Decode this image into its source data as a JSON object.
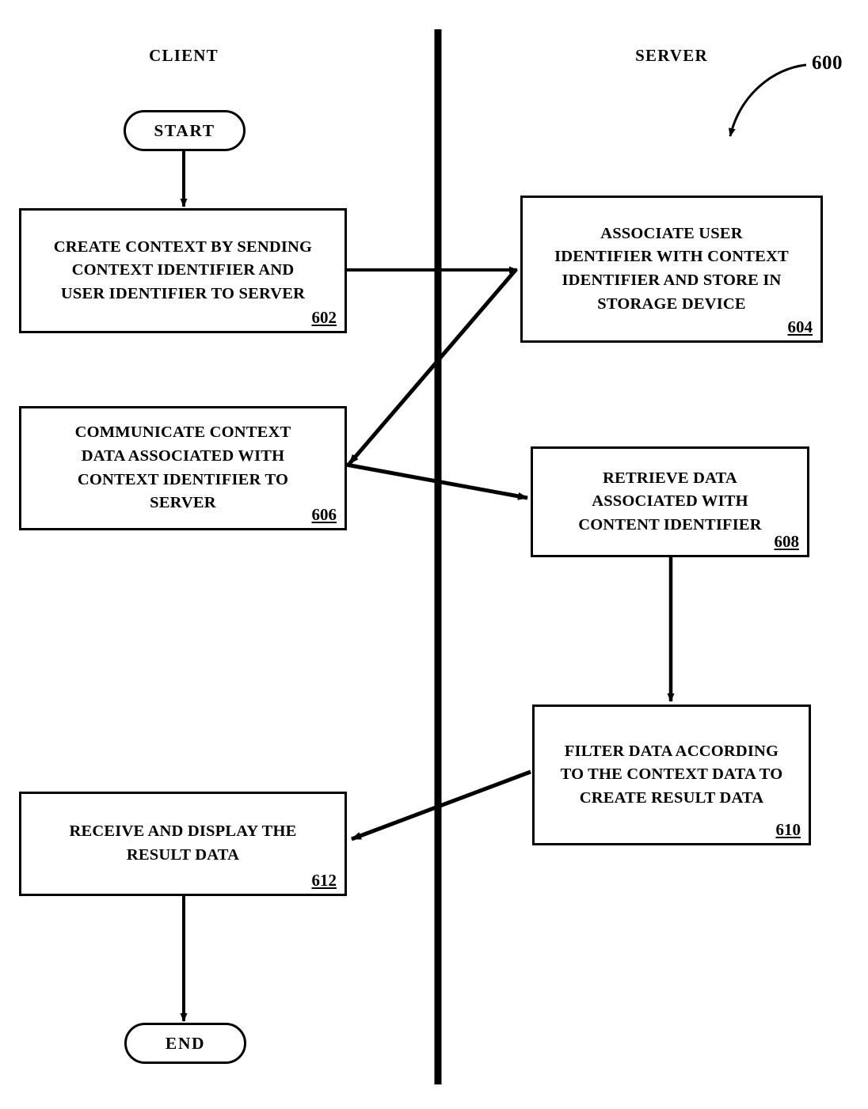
{
  "figure": {
    "reference_numeral": "600",
    "lanes": [
      {
        "id": "client",
        "label": "CLIENT"
      },
      {
        "id": "server",
        "label": "SERVER"
      }
    ]
  },
  "nodes": {
    "start": {
      "label": "START",
      "shape": "terminator"
    },
    "end": {
      "label": "END",
      "shape": "terminator"
    },
    "step602": {
      "number": "602",
      "lane": "client",
      "lines": [
        "CREATE CONTEXT BY SENDING",
        "CONTEXT IDENTIFIER AND",
        "USER IDENTIFIER TO SERVER"
      ]
    },
    "step604": {
      "number": "604",
      "lane": "server",
      "lines": [
        "ASSOCIATE USER",
        "IDENTIFIER WITH CONTEXT",
        "IDENTIFIER AND STORE IN",
        "STORAGE DEVICE"
      ]
    },
    "step606": {
      "number": "606",
      "lane": "client",
      "lines": [
        "COMMUNICATE CONTEXT",
        "DATA ASSOCIATED WITH",
        "CONTEXT IDENTIFIER TO",
        "SERVER"
      ]
    },
    "step608": {
      "number": "608",
      "lane": "server",
      "lines": [
        "RETRIEVE DATA",
        "ASSOCIATED WITH",
        "CONTENT IDENTIFIER"
      ]
    },
    "step610": {
      "number": "610",
      "lane": "server",
      "lines": [
        "FILTER DATA ACCORDING",
        "TO THE CONTEXT DATA TO",
        "CREATE RESULT DATA"
      ]
    },
    "step612": {
      "number": "612",
      "lane": "client",
      "lines": [
        "RECEIVE AND DISPLAY THE",
        "RESULT DATA"
      ]
    }
  },
  "edges": [
    {
      "from": "start",
      "to": "step602",
      "style": "straight-vertical"
    },
    {
      "from": "step602",
      "to": "step604",
      "style": "elbow-horizontal"
    },
    {
      "from": "step604",
      "to": "step606",
      "style": "diagonal"
    },
    {
      "from": "step606",
      "to": "step608",
      "style": "diagonal"
    },
    {
      "from": "step608",
      "to": "step610",
      "style": "straight-vertical"
    },
    {
      "from": "step610",
      "to": "step612",
      "style": "diagonal"
    },
    {
      "from": "step612",
      "to": "end",
      "style": "straight-vertical"
    }
  ],
  "colors": {
    "stroke": "#000000",
    "fill": "#ffffff",
    "background": "#ffffff"
  }
}
